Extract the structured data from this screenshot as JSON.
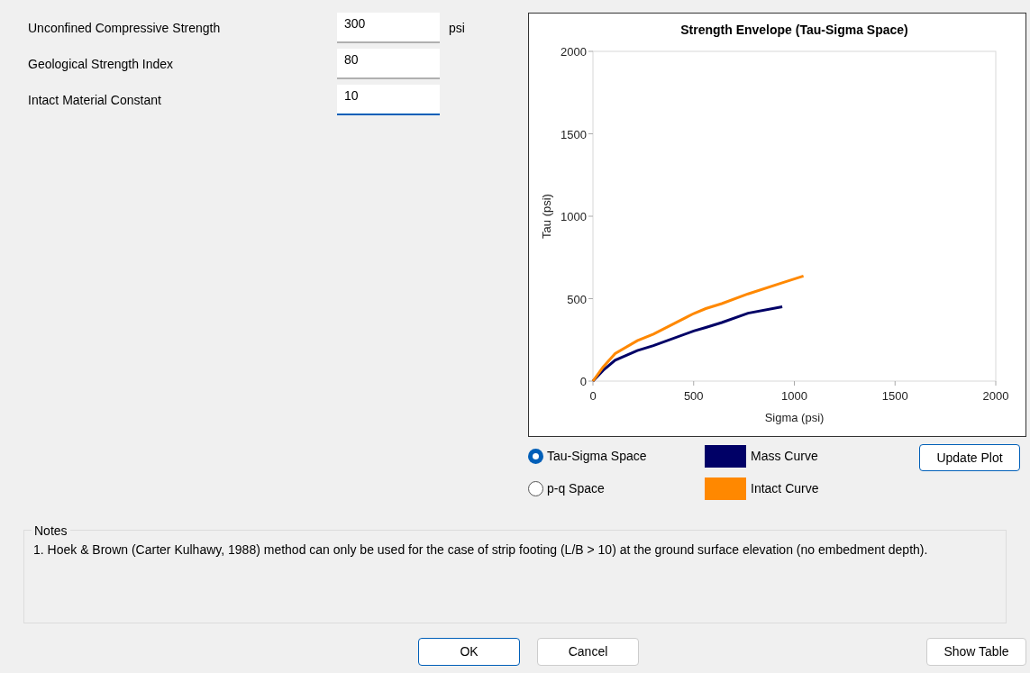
{
  "fields": [
    {
      "label": "Unconfined Compressive Strength",
      "value": "300",
      "unit": "psi",
      "focused": false
    },
    {
      "label": "Geological Strength Index",
      "value": "80",
      "focused": false
    },
    {
      "label": "Intact Material Constant",
      "value": "10",
      "focused": true
    }
  ],
  "chart": {
    "chart_data": {
      "type": "line",
      "title": "Strength Envelope (Tau-Sigma Space)",
      "xlabel": "Sigma (psi)",
      "ylabel": "Tau (psi)",
      "x": [
        0,
        50,
        110,
        220,
        300,
        500,
        560,
        640,
        770,
        940,
        1045
      ],
      "series": [
        {
          "name": "Mass Curve",
          "color": "#000066",
          "values": [
            0,
            65,
            127,
            185,
            215,
            304,
            325,
            355,
            412,
            451,
            null
          ]
        },
        {
          "name": "Intact Curve",
          "color": "#ff8800",
          "values": [
            0,
            85,
            167,
            245,
            285,
            410,
            440,
            470,
            529,
            596,
            637
          ]
        }
      ],
      "xlim": [
        0,
        2000
      ],
      "ylim": [
        0,
        2000
      ],
      "xticks": [
        0,
        500,
        1000,
        1500,
        2000
      ],
      "yticks": [
        0,
        500,
        1000,
        1500,
        2000
      ]
    }
  },
  "space_options": [
    {
      "label": "Tau-Sigma Space",
      "selected": true
    },
    {
      "label": "p-q Space",
      "selected": false
    }
  ],
  "update_button": "Update Plot",
  "notes": {
    "title": "Notes",
    "text": "1. Hoek & Brown (Carter  Kulhawy, 1988) method can only be used for the case of strip footing (L/B > 10) at the ground surface elevation (no embedment depth)."
  },
  "buttons": {
    "ok": "OK",
    "cancel": "Cancel",
    "show_table": "Show Table"
  }
}
